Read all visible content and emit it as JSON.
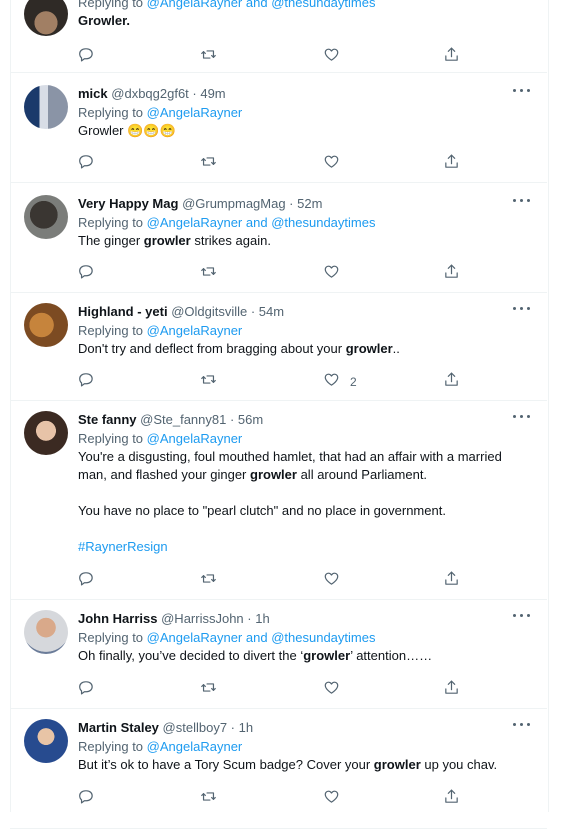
{
  "tweets": [
    {
      "name": "",
      "handle": "",
      "time": "",
      "replying_prefix": "Replying to",
      "mentions": [
        "@AngelaRayner",
        "and",
        "@thesundaytimes"
      ],
      "paragraphs": [
        [
          {
            "t": "Growler.",
            "bold": true
          }
        ]
      ],
      "likes": ""
    },
    {
      "name": "mick",
      "handle": "@dxbqg2gf6t · 49m",
      "replying_prefix": "Replying to",
      "mentions": [
        "@AngelaRayner"
      ],
      "paragraphs": [
        [
          {
            "t": "Growler 😁😁😁",
            "bold": false
          }
        ]
      ],
      "likes": ""
    },
    {
      "name": "Very Happy Mag",
      "handle": "@GrumpmagMag · 52m",
      "replying_prefix": "Replying to",
      "mentions": [
        "@AngelaRayner",
        "and",
        "@thesundaytimes"
      ],
      "paragraphs": [
        [
          {
            "t": "The ginger ",
            "bold": false
          },
          {
            "t": "growler",
            "bold": true
          },
          {
            "t": " strikes again.",
            "bold": false
          }
        ]
      ],
      "likes": ""
    },
    {
      "name": "Highland - yeti",
      "handle": "@Oldgitsville · 54m",
      "replying_prefix": "Replying to",
      "mentions": [
        "@AngelaRayner"
      ],
      "paragraphs": [
        [
          {
            "t": "Don't try and deflect from bragging about your ",
            "bold": false
          },
          {
            "t": "growler",
            "bold": true
          },
          {
            "t": "..",
            "bold": false
          }
        ]
      ],
      "likes": "2"
    },
    {
      "name": "Ste fanny",
      "handle": "@Ste_fanny81 · 56m",
      "replying_prefix": "Replying to",
      "mentions": [
        "@AngelaRayner"
      ],
      "paragraphs": [
        [
          {
            "t": "You're a disgusting, foul mouthed hamlet, that had an affair with a married man, and flashed your ginger ",
            "bold": false
          },
          {
            "t": "growler",
            "bold": true
          },
          {
            "t": " all around Parliament.",
            "bold": false
          }
        ],
        [
          {
            "t": "You have no place to \"pearl clutch\" and no place in government.",
            "bold": false
          }
        ],
        [
          {
            "t": "#RaynerResign",
            "bold": false,
            "tag": true
          }
        ]
      ],
      "likes": ""
    },
    {
      "name": "John Harriss",
      "handle": "@HarrissJohn · 1h",
      "replying_prefix": "Replying to",
      "mentions": [
        "@AngelaRayner",
        "and",
        "@thesundaytimes"
      ],
      "paragraphs": [
        [
          {
            "t": "Oh finally, you’ve decided to divert the ‘",
            "bold": false
          },
          {
            "t": "growler",
            "bold": true
          },
          {
            "t": "’ attention……",
            "bold": false
          }
        ]
      ],
      "likes": ""
    },
    {
      "name": "Martin Staley",
      "handle": "@stellboy7 · 1h",
      "replying_prefix": "Replying to",
      "mentions": [
        "@AngelaRayner"
      ],
      "paragraphs": [
        [
          {
            "t": "But it’s ok to have a Tory Scum badge? Cover your ",
            "bold": false
          },
          {
            "t": "growler",
            "bold": true
          },
          {
            "t": " up you chav.",
            "bold": false
          }
        ]
      ],
      "likes": ""
    }
  ],
  "icons": {
    "reply": "reply-icon",
    "retweet": "retweet-icon",
    "like": "like-icon",
    "share": "share-icon",
    "more": "more-icon"
  },
  "colors": {
    "link": "#1d9bf0",
    "muted": "#536471",
    "text": "#0f1419",
    "divider": "#eff3f4"
  }
}
